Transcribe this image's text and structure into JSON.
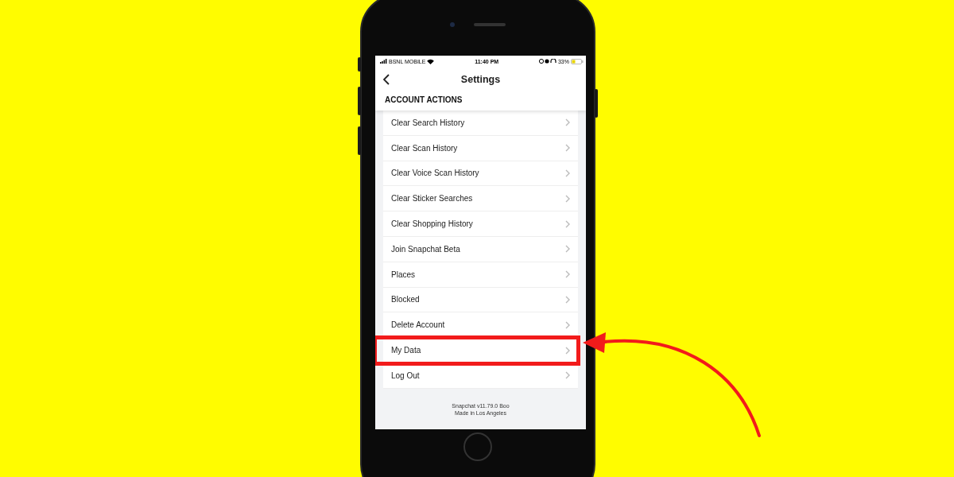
{
  "status_bar": {
    "carrier": "BSNL MOBILE",
    "time": "11:40 PM",
    "battery": "33%"
  },
  "nav": {
    "title": "Settings"
  },
  "section": {
    "title": "ACCOUNT ACTIONS"
  },
  "items": [
    {
      "label": "Clear Search History",
      "highlighted": false
    },
    {
      "label": "Clear Scan History",
      "highlighted": false
    },
    {
      "label": "Clear Voice Scan History",
      "highlighted": false
    },
    {
      "label": "Clear Sticker Searches",
      "highlighted": false
    },
    {
      "label": "Clear Shopping History",
      "highlighted": false
    },
    {
      "label": "Join Snapchat Beta",
      "highlighted": false
    },
    {
      "label": "Places",
      "highlighted": false
    },
    {
      "label": "Blocked",
      "highlighted": false
    },
    {
      "label": "Delete Account",
      "highlighted": false
    },
    {
      "label": "My Data",
      "highlighted": true
    },
    {
      "label": "Log Out",
      "highlighted": false
    }
  ],
  "footer": {
    "version": "Snapchat v11.79.0 Boo",
    "location": "Made in Los Angeles"
  }
}
